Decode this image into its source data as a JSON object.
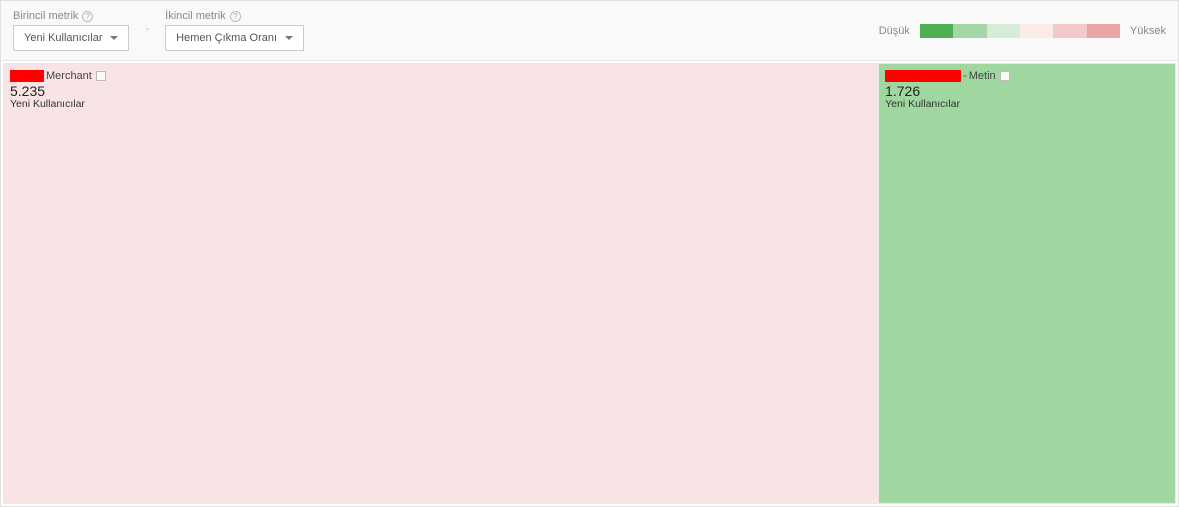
{
  "toolbar": {
    "primary_label": "Birincil metrik",
    "secondary_label": "İkincil metrik",
    "primary_value": "Yeni Kullanıcılar",
    "secondary_value": "Hemen Çıkma Oranı",
    "separator": "-"
  },
  "legend": {
    "low_label": "Düşük",
    "high_label": "Yüksek"
  },
  "cells": [
    {
      "name_suffix": "Merchant",
      "prefix": " - ",
      "value": "5.235",
      "sublabel": "Yeni Kullanıcılar"
    },
    {
      "name_suffix": "Metin",
      "prefix": " - ",
      "value": "1.726",
      "sublabel": "Yeni Kullanıcılar"
    }
  ],
  "chart_data": {
    "type": "treemap",
    "title": "",
    "size_metric": "Yeni Kullanıcılar",
    "color_metric": "Hemen Çıkma Oranı",
    "color_scale": {
      "low_label": "Düşük",
      "high_label": "Yüksek"
    },
    "series": [
      {
        "name": "Merchant",
        "value": 5235,
        "color_bucket": "high"
      },
      {
        "name": "Metin",
        "value": 1726,
        "color_bucket": "low"
      }
    ]
  }
}
